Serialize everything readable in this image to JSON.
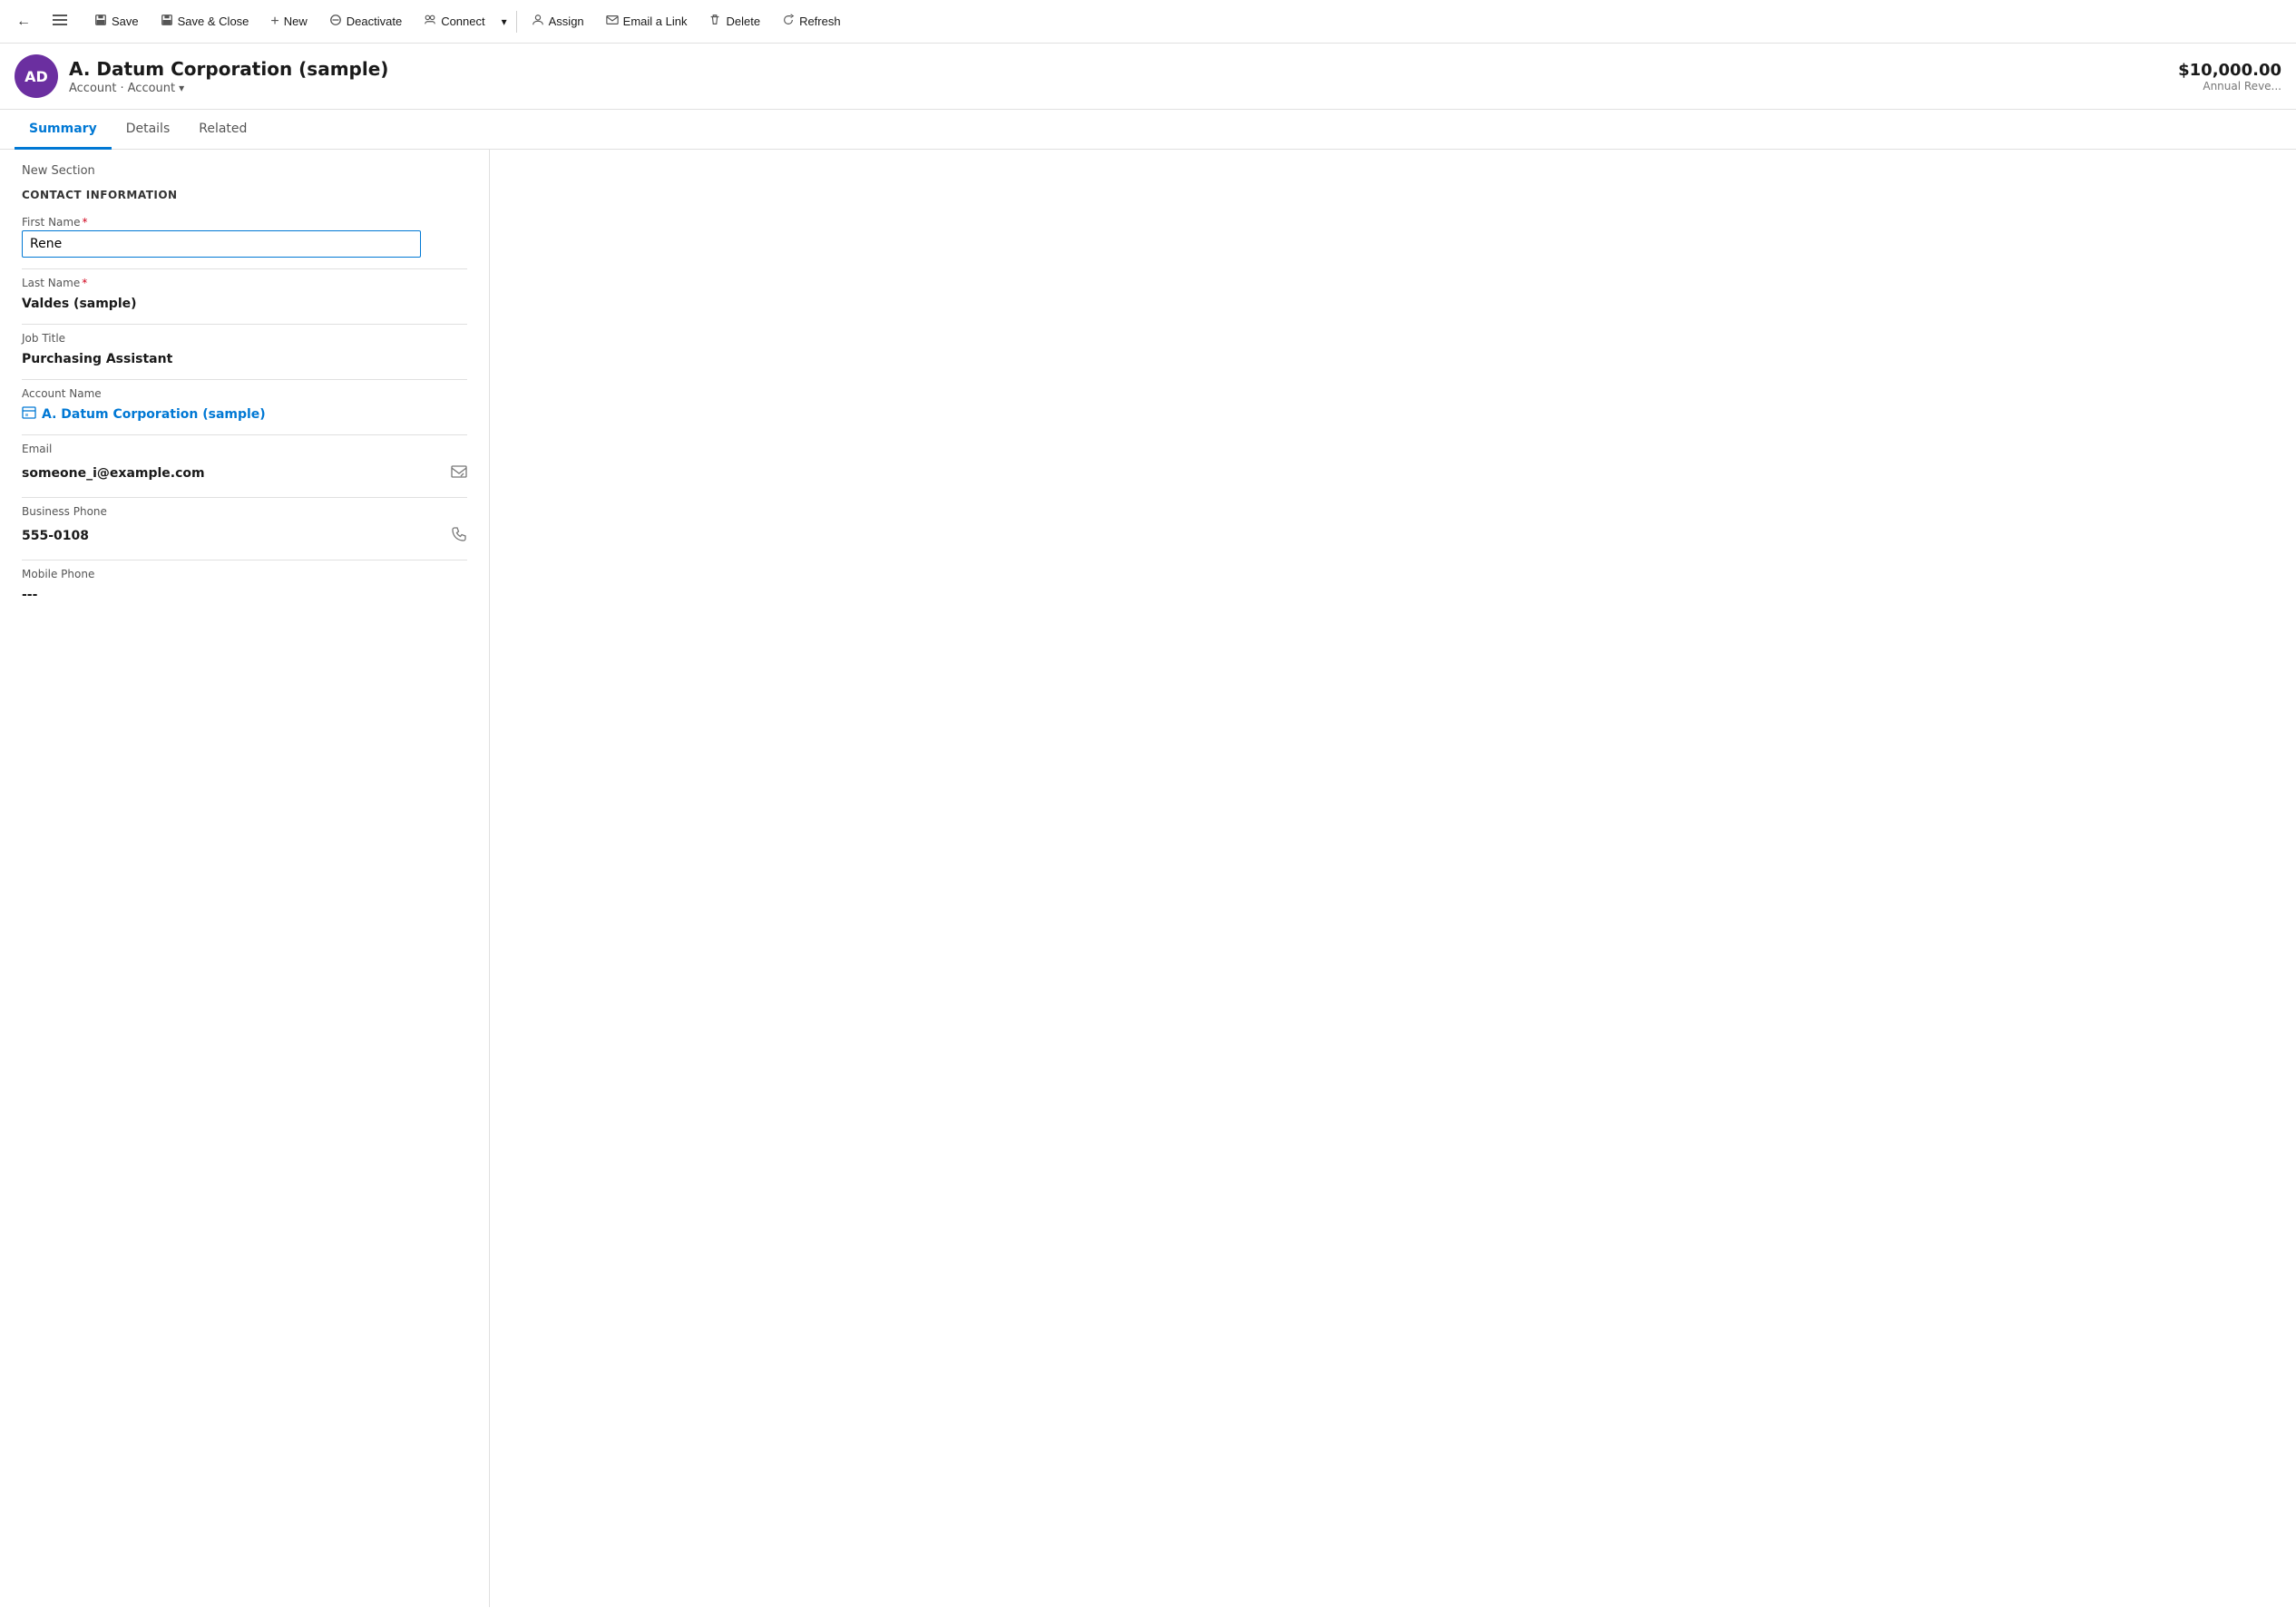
{
  "toolbar": {
    "back_label": "←",
    "menu_label": "≡",
    "save_label": "Save",
    "save_close_label": "Save & Close",
    "new_label": "New",
    "deactivate_label": "Deactivate",
    "connect_label": "Connect",
    "more_label": "⌄",
    "assign_label": "Assign",
    "email_link_label": "Email a Link",
    "delete_label": "Delete",
    "refresh_label": "Refresh",
    "save_icon": "💾",
    "save_close_icon": "💾",
    "new_icon": "+",
    "deactivate_icon": "⊘",
    "connect_icon": "👥",
    "assign_icon": "👤",
    "email_icon": "✉",
    "delete_icon": "🗑",
    "refresh_icon": "↻"
  },
  "record": {
    "avatar_text": "AD",
    "title": "A. Datum Corporation (sample)",
    "breadcrumb_type": "Account",
    "breadcrumb_entity": "Account",
    "annual_revenue": "$10,000.00",
    "annual_revenue_label": "Annual Reve..."
  },
  "tabs": {
    "summary_label": "Summary",
    "details_label": "Details",
    "related_label": "Related"
  },
  "form": {
    "new_section_label": "New Section",
    "contact_info_title": "CONTACT INFORMATION",
    "first_name_label": "First Name",
    "first_name_value": "Rene",
    "last_name_label": "Last Name",
    "last_name_value": "Valdes (sample)",
    "job_title_label": "Job Title",
    "job_title_value": "Purchasing Assistant",
    "account_name_label": "Account Name",
    "account_name_value": "A. Datum Corporation (sample)",
    "email_label": "Email",
    "email_value": "someone_i@example.com",
    "business_phone_label": "Business Phone",
    "business_phone_value": "555-0108",
    "mobile_phone_label": "Mobile Phone",
    "mobile_phone_value": "---"
  }
}
